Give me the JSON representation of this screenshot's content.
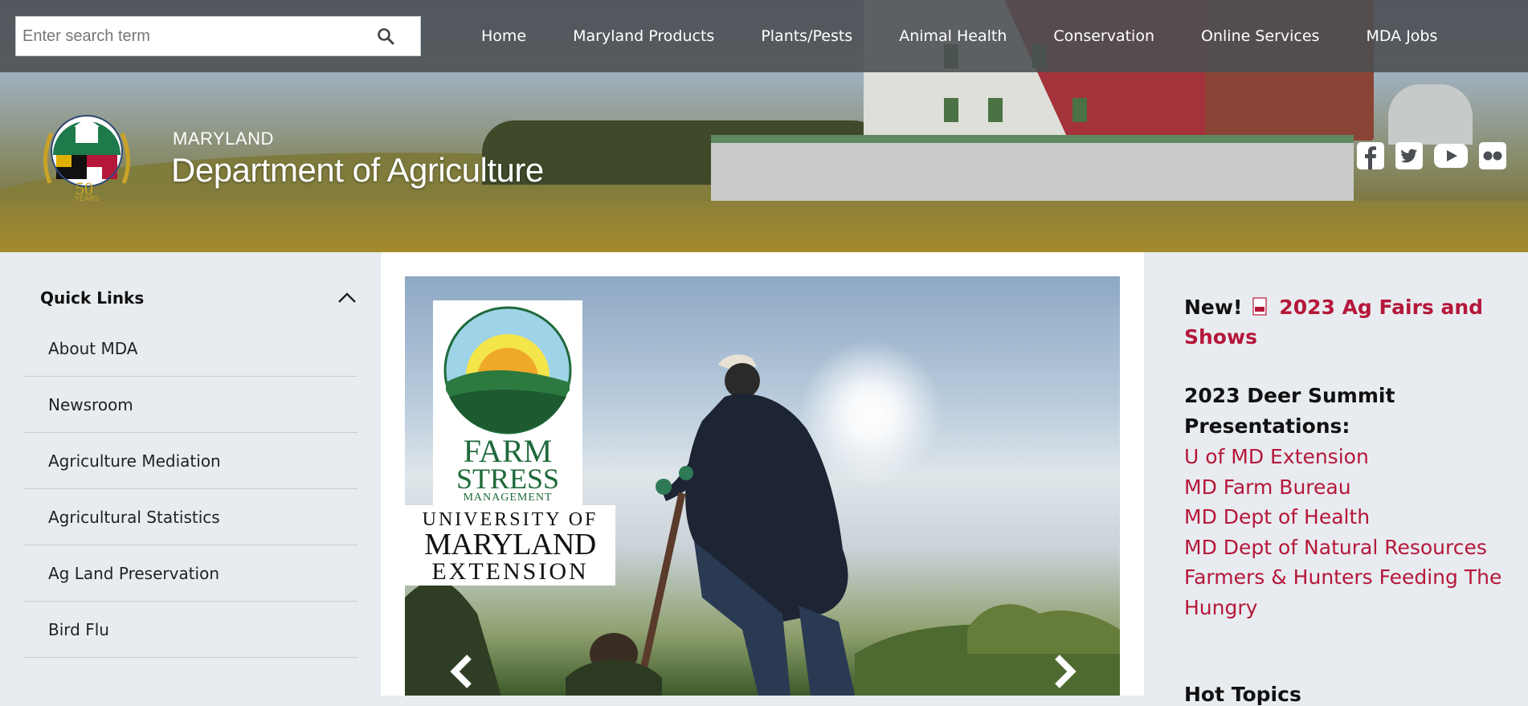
{
  "search": {
    "placeholder": "Enter search term"
  },
  "nav": {
    "items": [
      {
        "label": "Home"
      },
      {
        "label": "Maryland Products"
      },
      {
        "label": "Plants/Pests"
      },
      {
        "label": "Animal Health"
      },
      {
        "label": "Conservation"
      },
      {
        "label": "Online Services"
      },
      {
        "label": "MDA Jobs"
      }
    ]
  },
  "site": {
    "state": "MARYLAND",
    "title": "Department of Agriculture",
    "logo_badge": "50",
    "logo_years": "YEARS"
  },
  "social": [
    "facebook-icon",
    "twitter-icon",
    "youtube-icon",
    "flickr-icon"
  ],
  "sidebar": {
    "title": "Quick Links",
    "items": [
      {
        "label": "About MDA"
      },
      {
        "label": "Newsroom"
      },
      {
        "label": "Agriculture Mediation"
      },
      {
        "label": "Agricultural Statistics"
      },
      {
        "label": "Ag Land Preservation"
      },
      {
        "label": "Bird Flu"
      }
    ]
  },
  "slider": {
    "logo_line1": "FARM",
    "logo_line2": "STRESS",
    "logo_line3": "MANAGEMENT",
    "umd_line1": "UNIVERSITY OF",
    "umd_line2": "MARYLAND",
    "umd_line3": "EXTENSION"
  },
  "right": {
    "new_label": "New!",
    "fairs_link": "2023 Ag Fairs and Shows",
    "deer_heading": "2023 Deer Summit Presentations:",
    "deer_links": [
      {
        "label": "U of MD Extension"
      },
      {
        "label": "MD Farm Bureau"
      },
      {
        "label": "MD Dept of Health"
      },
      {
        "label": "MD Dept of Natural Resources"
      },
      {
        "label": "Farmers & Hunters Feeding The Hungry"
      }
    ],
    "hot_topics": "Hot Topics"
  },
  "colors": {
    "link_red": "#b5173a",
    "topbar": "#4b4e52",
    "sidebar_bg": "#e8ecf0"
  }
}
